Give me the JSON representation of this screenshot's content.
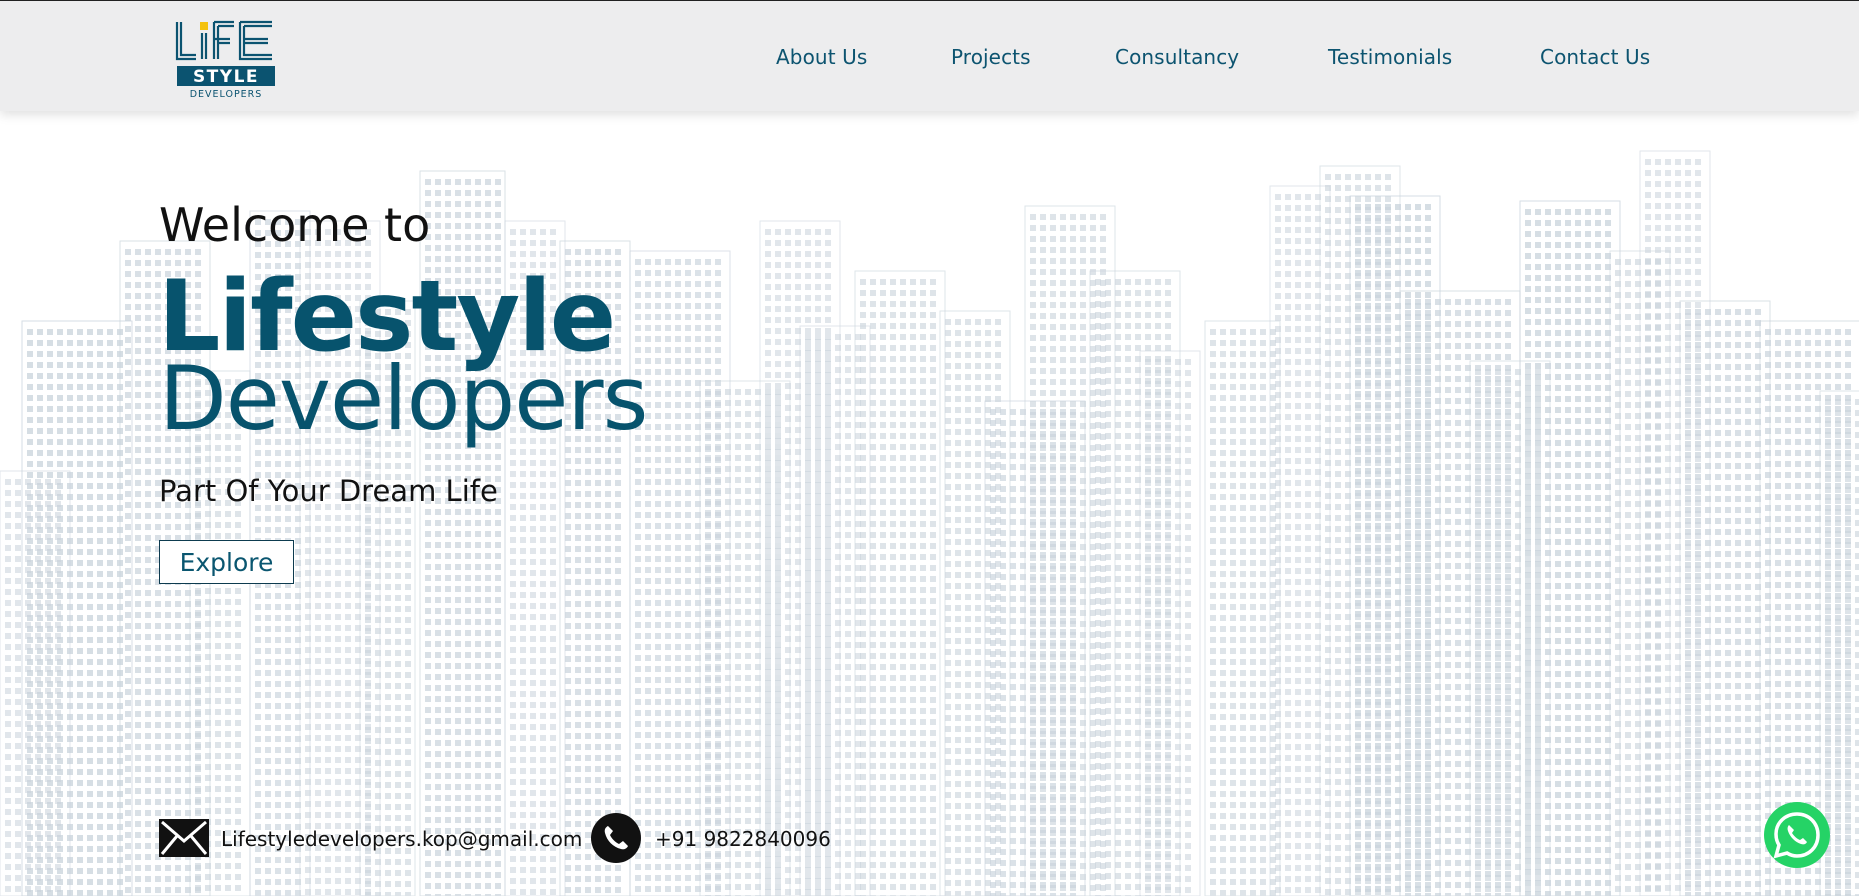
{
  "header": {
    "logo": {
      "word": "LiFE",
      "sub": "STYLE",
      "tag": "DEVELOPERS"
    },
    "nav": [
      {
        "label": "About Us"
      },
      {
        "label": "Projects"
      },
      {
        "label": "Consultancy"
      },
      {
        "label": "Testimonials"
      },
      {
        "label": "Contact Us"
      }
    ]
  },
  "hero": {
    "welcome": "Welcome to",
    "brand_line1": "Lifestyle",
    "brand_line2": "Developers",
    "tagline": "Part Of Your Dream Life",
    "explore_label": "Explore"
  },
  "contact": {
    "email": "Lifestyledevelopers.kop@gmail.com",
    "phone": "+91 9822840096"
  },
  "icons": {
    "email": "envelope-icon",
    "phone": "phone-icon",
    "whatsapp": "whatsapp-icon"
  },
  "colors": {
    "brand": "#07536d",
    "header_bg": "#ededee",
    "logo_accent": "#f4c20d",
    "whatsapp": "#25d366",
    "skyline": "#c9d3dc"
  }
}
